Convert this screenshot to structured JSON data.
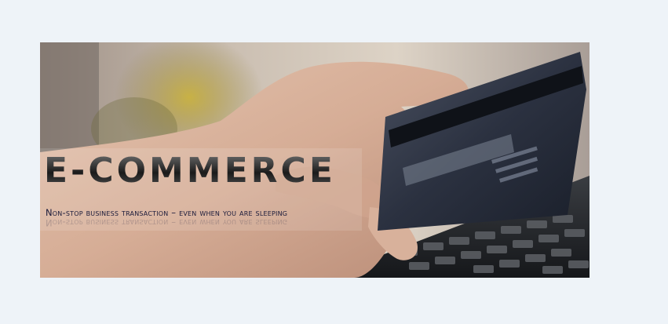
{
  "banner": {
    "title": "E-commerce",
    "subtitle": "Non-stop business transaction – even when you are sleeping"
  },
  "colors": {
    "page_background": "#eef3f8",
    "title_dark": "#1b1b1b",
    "subtitle_navy": "#1a1a3a",
    "card_dark": "#1e2430",
    "keyboard_dark": "#23262b"
  },
  "icons": [
    "credit-card-icon",
    "keyboard-icon",
    "hand-icon"
  ]
}
